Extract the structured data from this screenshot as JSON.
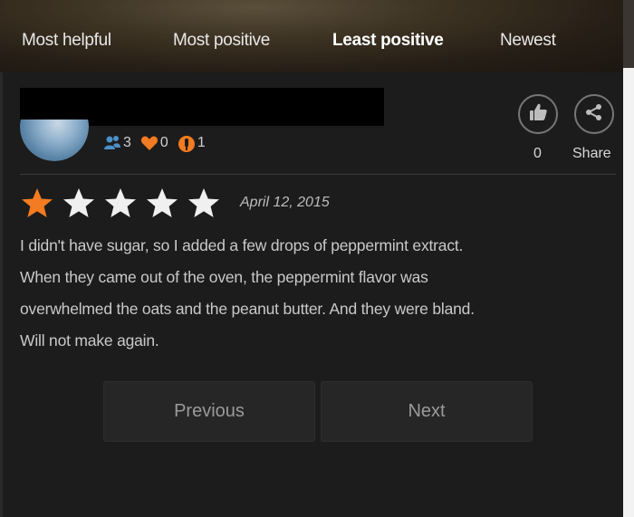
{
  "tabs": [
    {
      "label": "Most helpful"
    },
    {
      "label": "Most positive"
    },
    {
      "label": "Least positive",
      "active": true
    },
    {
      "label": "Newest"
    }
  ],
  "review": {
    "reviewer_stats": {
      "followers": "3",
      "favorites": "0",
      "made_it": "1"
    },
    "likes": "0",
    "share_label": "Share",
    "rating": 1,
    "rating_max": 5,
    "date": "April 12, 2015",
    "text_lines": [
      "I didn't have sugar, so I added a few drops of peppermint extract.",
      "When they came out of the oven, the peppermint flavor was",
      "overwhelmed the oats and the peanut butter. And they were bland.",
      "Will not make again."
    ]
  },
  "pagination": {
    "previous_label": "Previous",
    "next_label": "Next"
  },
  "colors": {
    "star_filled": "#f37b21",
    "star_empty": "#f0f0f0",
    "heart": "#f37b21",
    "made_it_icon": "#f37b21",
    "followers_icon": "#4a90c8",
    "background": "#1c1c1c"
  },
  "icons": {
    "followers": "followers-icon",
    "favorites": "heart-icon",
    "made_it": "made-it-icon",
    "like": "thumbs-up-icon",
    "share": "share-icon",
    "star": "star-icon"
  }
}
